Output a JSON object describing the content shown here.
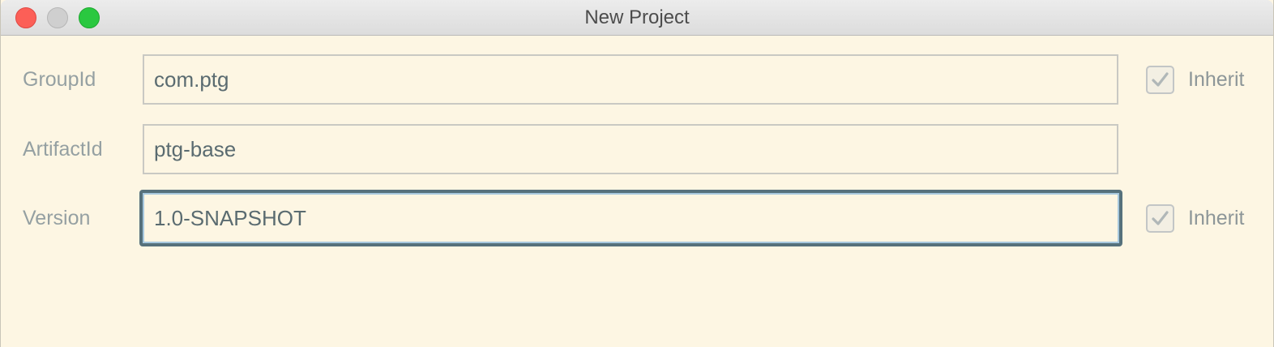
{
  "window": {
    "title": "New Project"
  },
  "form": {
    "group_id": {
      "label": "GroupId",
      "value": "com.ptg",
      "inherit_label": "Inherit",
      "inherit_checked": true
    },
    "artifact_id": {
      "label": "ArtifactId",
      "value": "ptg-base"
    },
    "version": {
      "label": "Version",
      "value": "1.0-SNAPSHOT",
      "inherit_label": "Inherit",
      "inherit_checked": true
    }
  },
  "colors": {
    "background": "#fdf6e3",
    "focus_border": "#56717c",
    "close": "#fc5f57",
    "zoom": "#2ac840"
  }
}
